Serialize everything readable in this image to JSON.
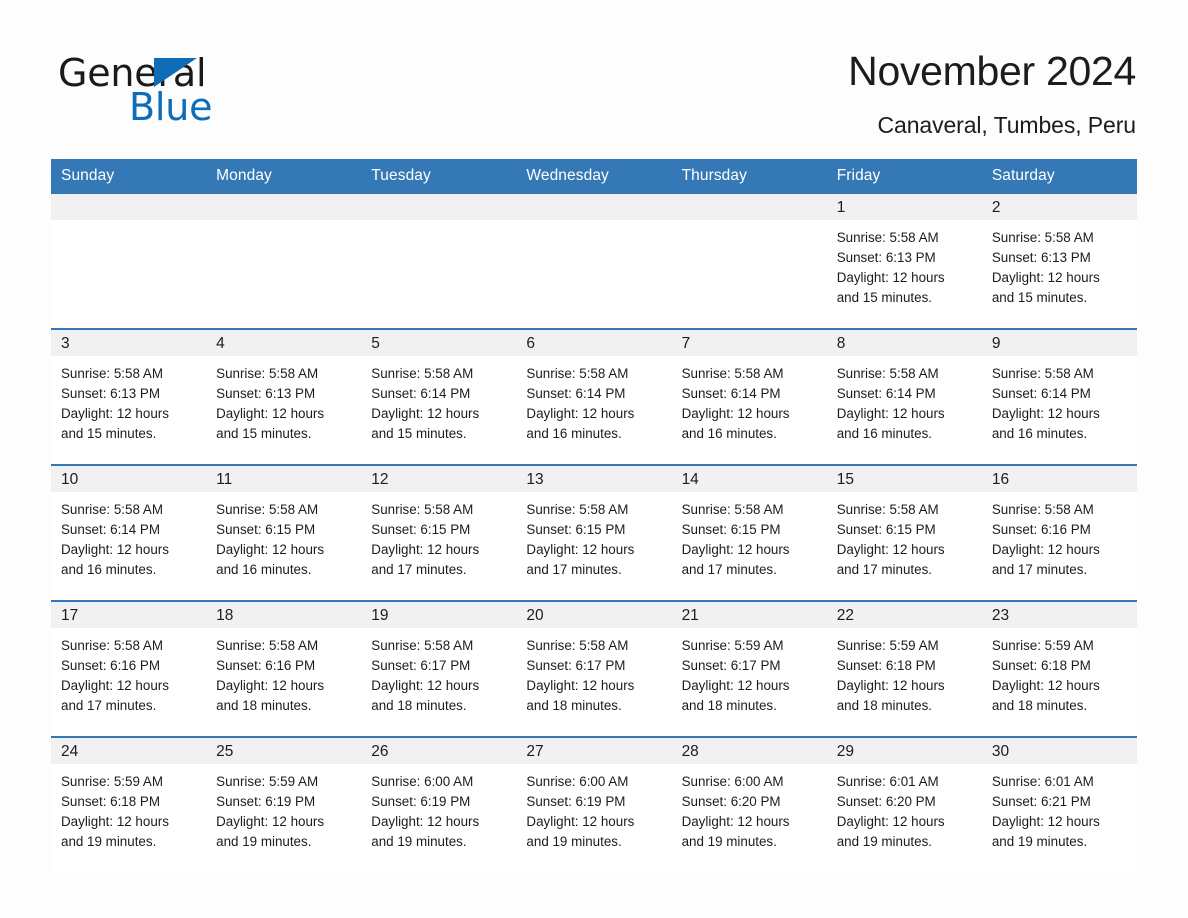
{
  "brand": {
    "name_part1": "General",
    "name_part2": "Blue",
    "triangle_color": "#0f6cb6"
  },
  "header": {
    "month_title": "November 2024",
    "location": "Canaveral, Tumbes, Peru",
    "accent_color": "#3479b5"
  },
  "weekdays": [
    "Sunday",
    "Monday",
    "Tuesday",
    "Wednesday",
    "Thursday",
    "Friday",
    "Saturday"
  ],
  "weeks": [
    [
      {
        "day": "",
        "sunrise": "",
        "sunset": "",
        "daylight1": "",
        "daylight2": "",
        "empty": true
      },
      {
        "day": "",
        "sunrise": "",
        "sunset": "",
        "daylight1": "",
        "daylight2": "",
        "empty": true
      },
      {
        "day": "",
        "sunrise": "",
        "sunset": "",
        "daylight1": "",
        "daylight2": "",
        "empty": true
      },
      {
        "day": "",
        "sunrise": "",
        "sunset": "",
        "daylight1": "",
        "daylight2": "",
        "empty": true
      },
      {
        "day": "",
        "sunrise": "",
        "sunset": "",
        "daylight1": "",
        "daylight2": "",
        "empty": true
      },
      {
        "day": "1",
        "sunrise": "Sunrise: 5:58 AM",
        "sunset": "Sunset: 6:13 PM",
        "daylight1": "Daylight: 12 hours",
        "daylight2": "and 15 minutes.",
        "empty": false
      },
      {
        "day": "2",
        "sunrise": "Sunrise: 5:58 AM",
        "sunset": "Sunset: 6:13 PM",
        "daylight1": "Daylight: 12 hours",
        "daylight2": "and 15 minutes.",
        "empty": false
      }
    ],
    [
      {
        "day": "3",
        "sunrise": "Sunrise: 5:58 AM",
        "sunset": "Sunset: 6:13 PM",
        "daylight1": "Daylight: 12 hours",
        "daylight2": "and 15 minutes.",
        "empty": false
      },
      {
        "day": "4",
        "sunrise": "Sunrise: 5:58 AM",
        "sunset": "Sunset: 6:13 PM",
        "daylight1": "Daylight: 12 hours",
        "daylight2": "and 15 minutes.",
        "empty": false
      },
      {
        "day": "5",
        "sunrise": "Sunrise: 5:58 AM",
        "sunset": "Sunset: 6:14 PM",
        "daylight1": "Daylight: 12 hours",
        "daylight2": "and 15 minutes.",
        "empty": false
      },
      {
        "day": "6",
        "sunrise": "Sunrise: 5:58 AM",
        "sunset": "Sunset: 6:14 PM",
        "daylight1": "Daylight: 12 hours",
        "daylight2": "and 16 minutes.",
        "empty": false
      },
      {
        "day": "7",
        "sunrise": "Sunrise: 5:58 AM",
        "sunset": "Sunset: 6:14 PM",
        "daylight1": "Daylight: 12 hours",
        "daylight2": "and 16 minutes.",
        "empty": false
      },
      {
        "day": "8",
        "sunrise": "Sunrise: 5:58 AM",
        "sunset": "Sunset: 6:14 PM",
        "daylight1": "Daylight: 12 hours",
        "daylight2": "and 16 minutes.",
        "empty": false
      },
      {
        "day": "9",
        "sunrise": "Sunrise: 5:58 AM",
        "sunset": "Sunset: 6:14 PM",
        "daylight1": "Daylight: 12 hours",
        "daylight2": "and 16 minutes.",
        "empty": false
      }
    ],
    [
      {
        "day": "10",
        "sunrise": "Sunrise: 5:58 AM",
        "sunset": "Sunset: 6:14 PM",
        "daylight1": "Daylight: 12 hours",
        "daylight2": "and 16 minutes.",
        "empty": false
      },
      {
        "day": "11",
        "sunrise": "Sunrise: 5:58 AM",
        "sunset": "Sunset: 6:15 PM",
        "daylight1": "Daylight: 12 hours",
        "daylight2": "and 16 minutes.",
        "empty": false
      },
      {
        "day": "12",
        "sunrise": "Sunrise: 5:58 AM",
        "sunset": "Sunset: 6:15 PM",
        "daylight1": "Daylight: 12 hours",
        "daylight2": "and 17 minutes.",
        "empty": false
      },
      {
        "day": "13",
        "sunrise": "Sunrise: 5:58 AM",
        "sunset": "Sunset: 6:15 PM",
        "daylight1": "Daylight: 12 hours",
        "daylight2": "and 17 minutes.",
        "empty": false
      },
      {
        "day": "14",
        "sunrise": "Sunrise: 5:58 AM",
        "sunset": "Sunset: 6:15 PM",
        "daylight1": "Daylight: 12 hours",
        "daylight2": "and 17 minutes.",
        "empty": false
      },
      {
        "day": "15",
        "sunrise": "Sunrise: 5:58 AM",
        "sunset": "Sunset: 6:15 PM",
        "daylight1": "Daylight: 12 hours",
        "daylight2": "and 17 minutes.",
        "empty": false
      },
      {
        "day": "16",
        "sunrise": "Sunrise: 5:58 AM",
        "sunset": "Sunset: 6:16 PM",
        "daylight1": "Daylight: 12 hours",
        "daylight2": "and 17 minutes.",
        "empty": false
      }
    ],
    [
      {
        "day": "17",
        "sunrise": "Sunrise: 5:58 AM",
        "sunset": "Sunset: 6:16 PM",
        "daylight1": "Daylight: 12 hours",
        "daylight2": "and 17 minutes.",
        "empty": false
      },
      {
        "day": "18",
        "sunrise": "Sunrise: 5:58 AM",
        "sunset": "Sunset: 6:16 PM",
        "daylight1": "Daylight: 12 hours",
        "daylight2": "and 18 minutes.",
        "empty": false
      },
      {
        "day": "19",
        "sunrise": "Sunrise: 5:58 AM",
        "sunset": "Sunset: 6:17 PM",
        "daylight1": "Daylight: 12 hours",
        "daylight2": "and 18 minutes.",
        "empty": false
      },
      {
        "day": "20",
        "sunrise": "Sunrise: 5:58 AM",
        "sunset": "Sunset: 6:17 PM",
        "daylight1": "Daylight: 12 hours",
        "daylight2": "and 18 minutes.",
        "empty": false
      },
      {
        "day": "21",
        "sunrise": "Sunrise: 5:59 AM",
        "sunset": "Sunset: 6:17 PM",
        "daylight1": "Daylight: 12 hours",
        "daylight2": "and 18 minutes.",
        "empty": false
      },
      {
        "day": "22",
        "sunrise": "Sunrise: 5:59 AM",
        "sunset": "Sunset: 6:18 PM",
        "daylight1": "Daylight: 12 hours",
        "daylight2": "and 18 minutes.",
        "empty": false
      },
      {
        "day": "23",
        "sunrise": "Sunrise: 5:59 AM",
        "sunset": "Sunset: 6:18 PM",
        "daylight1": "Daylight: 12 hours",
        "daylight2": "and 18 minutes.",
        "empty": false
      }
    ],
    [
      {
        "day": "24",
        "sunrise": "Sunrise: 5:59 AM",
        "sunset": "Sunset: 6:18 PM",
        "daylight1": "Daylight: 12 hours",
        "daylight2": "and 19 minutes.",
        "empty": false
      },
      {
        "day": "25",
        "sunrise": "Sunrise: 5:59 AM",
        "sunset": "Sunset: 6:19 PM",
        "daylight1": "Daylight: 12 hours",
        "daylight2": "and 19 minutes.",
        "empty": false
      },
      {
        "day": "26",
        "sunrise": "Sunrise: 6:00 AM",
        "sunset": "Sunset: 6:19 PM",
        "daylight1": "Daylight: 12 hours",
        "daylight2": "and 19 minutes.",
        "empty": false
      },
      {
        "day": "27",
        "sunrise": "Sunrise: 6:00 AM",
        "sunset": "Sunset: 6:19 PM",
        "daylight1": "Daylight: 12 hours",
        "daylight2": "and 19 minutes.",
        "empty": false
      },
      {
        "day": "28",
        "sunrise": "Sunrise: 6:00 AM",
        "sunset": "Sunset: 6:20 PM",
        "daylight1": "Daylight: 12 hours",
        "daylight2": "and 19 minutes.",
        "empty": false
      },
      {
        "day": "29",
        "sunrise": "Sunrise: 6:01 AM",
        "sunset": "Sunset: 6:20 PM",
        "daylight1": "Daylight: 12 hours",
        "daylight2": "and 19 minutes.",
        "empty": false
      },
      {
        "day": "30",
        "sunrise": "Sunrise: 6:01 AM",
        "sunset": "Sunset: 6:21 PM",
        "daylight1": "Daylight: 12 hours",
        "daylight2": "and 19 minutes.",
        "empty": false
      }
    ]
  ]
}
